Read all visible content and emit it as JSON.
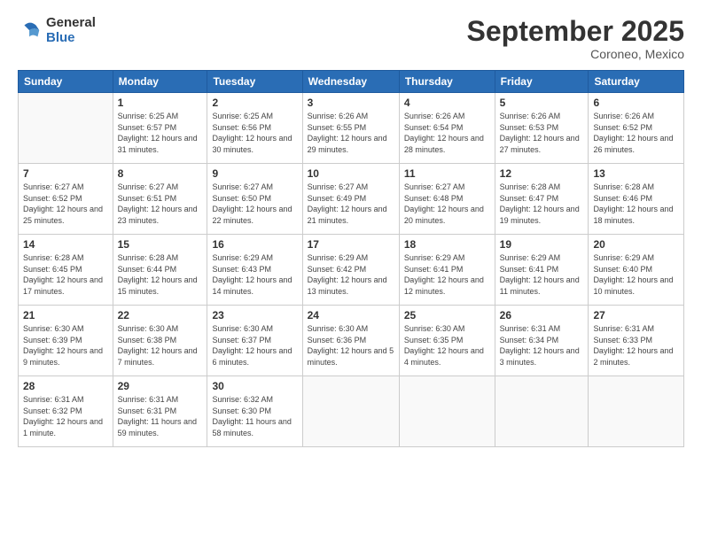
{
  "logo": {
    "general": "General",
    "blue": "Blue"
  },
  "header": {
    "month": "September 2025",
    "location": "Coroneo, Mexico"
  },
  "weekdays": [
    "Sunday",
    "Monday",
    "Tuesday",
    "Wednesday",
    "Thursday",
    "Friday",
    "Saturday"
  ],
  "weeks": [
    [
      {
        "day": "",
        "sunrise": "",
        "sunset": "",
        "daylight": ""
      },
      {
        "day": "1",
        "sunrise": "Sunrise: 6:25 AM",
        "sunset": "Sunset: 6:57 PM",
        "daylight": "Daylight: 12 hours and 31 minutes."
      },
      {
        "day": "2",
        "sunrise": "Sunrise: 6:25 AM",
        "sunset": "Sunset: 6:56 PM",
        "daylight": "Daylight: 12 hours and 30 minutes."
      },
      {
        "day": "3",
        "sunrise": "Sunrise: 6:26 AM",
        "sunset": "Sunset: 6:55 PM",
        "daylight": "Daylight: 12 hours and 29 minutes."
      },
      {
        "day": "4",
        "sunrise": "Sunrise: 6:26 AM",
        "sunset": "Sunset: 6:54 PM",
        "daylight": "Daylight: 12 hours and 28 minutes."
      },
      {
        "day": "5",
        "sunrise": "Sunrise: 6:26 AM",
        "sunset": "Sunset: 6:53 PM",
        "daylight": "Daylight: 12 hours and 27 minutes."
      },
      {
        "day": "6",
        "sunrise": "Sunrise: 6:26 AM",
        "sunset": "Sunset: 6:52 PM",
        "daylight": "Daylight: 12 hours and 26 minutes."
      }
    ],
    [
      {
        "day": "7",
        "sunrise": "Sunrise: 6:27 AM",
        "sunset": "Sunset: 6:52 PM",
        "daylight": "Daylight: 12 hours and 25 minutes."
      },
      {
        "day": "8",
        "sunrise": "Sunrise: 6:27 AM",
        "sunset": "Sunset: 6:51 PM",
        "daylight": "Daylight: 12 hours and 23 minutes."
      },
      {
        "day": "9",
        "sunrise": "Sunrise: 6:27 AM",
        "sunset": "Sunset: 6:50 PM",
        "daylight": "Daylight: 12 hours and 22 minutes."
      },
      {
        "day": "10",
        "sunrise": "Sunrise: 6:27 AM",
        "sunset": "Sunset: 6:49 PM",
        "daylight": "Daylight: 12 hours and 21 minutes."
      },
      {
        "day": "11",
        "sunrise": "Sunrise: 6:27 AM",
        "sunset": "Sunset: 6:48 PM",
        "daylight": "Daylight: 12 hours and 20 minutes."
      },
      {
        "day": "12",
        "sunrise": "Sunrise: 6:28 AM",
        "sunset": "Sunset: 6:47 PM",
        "daylight": "Daylight: 12 hours and 19 minutes."
      },
      {
        "day": "13",
        "sunrise": "Sunrise: 6:28 AM",
        "sunset": "Sunset: 6:46 PM",
        "daylight": "Daylight: 12 hours and 18 minutes."
      }
    ],
    [
      {
        "day": "14",
        "sunrise": "Sunrise: 6:28 AM",
        "sunset": "Sunset: 6:45 PM",
        "daylight": "Daylight: 12 hours and 17 minutes."
      },
      {
        "day": "15",
        "sunrise": "Sunrise: 6:28 AM",
        "sunset": "Sunset: 6:44 PM",
        "daylight": "Daylight: 12 hours and 15 minutes."
      },
      {
        "day": "16",
        "sunrise": "Sunrise: 6:29 AM",
        "sunset": "Sunset: 6:43 PM",
        "daylight": "Daylight: 12 hours and 14 minutes."
      },
      {
        "day": "17",
        "sunrise": "Sunrise: 6:29 AM",
        "sunset": "Sunset: 6:42 PM",
        "daylight": "Daylight: 12 hours and 13 minutes."
      },
      {
        "day": "18",
        "sunrise": "Sunrise: 6:29 AM",
        "sunset": "Sunset: 6:41 PM",
        "daylight": "Daylight: 12 hours and 12 minutes."
      },
      {
        "day": "19",
        "sunrise": "Sunrise: 6:29 AM",
        "sunset": "Sunset: 6:41 PM",
        "daylight": "Daylight: 12 hours and 11 minutes."
      },
      {
        "day": "20",
        "sunrise": "Sunrise: 6:29 AM",
        "sunset": "Sunset: 6:40 PM",
        "daylight": "Daylight: 12 hours and 10 minutes."
      }
    ],
    [
      {
        "day": "21",
        "sunrise": "Sunrise: 6:30 AM",
        "sunset": "Sunset: 6:39 PM",
        "daylight": "Daylight: 12 hours and 9 minutes."
      },
      {
        "day": "22",
        "sunrise": "Sunrise: 6:30 AM",
        "sunset": "Sunset: 6:38 PM",
        "daylight": "Daylight: 12 hours and 7 minutes."
      },
      {
        "day": "23",
        "sunrise": "Sunrise: 6:30 AM",
        "sunset": "Sunset: 6:37 PM",
        "daylight": "Daylight: 12 hours and 6 minutes."
      },
      {
        "day": "24",
        "sunrise": "Sunrise: 6:30 AM",
        "sunset": "Sunset: 6:36 PM",
        "daylight": "Daylight: 12 hours and 5 minutes."
      },
      {
        "day": "25",
        "sunrise": "Sunrise: 6:30 AM",
        "sunset": "Sunset: 6:35 PM",
        "daylight": "Daylight: 12 hours and 4 minutes."
      },
      {
        "day": "26",
        "sunrise": "Sunrise: 6:31 AM",
        "sunset": "Sunset: 6:34 PM",
        "daylight": "Daylight: 12 hours and 3 minutes."
      },
      {
        "day": "27",
        "sunrise": "Sunrise: 6:31 AM",
        "sunset": "Sunset: 6:33 PM",
        "daylight": "Daylight: 12 hours and 2 minutes."
      }
    ],
    [
      {
        "day": "28",
        "sunrise": "Sunrise: 6:31 AM",
        "sunset": "Sunset: 6:32 PM",
        "daylight": "Daylight: 12 hours and 1 minute."
      },
      {
        "day": "29",
        "sunrise": "Sunrise: 6:31 AM",
        "sunset": "Sunset: 6:31 PM",
        "daylight": "Daylight: 11 hours and 59 minutes."
      },
      {
        "day": "30",
        "sunrise": "Sunrise: 6:32 AM",
        "sunset": "Sunset: 6:30 PM",
        "daylight": "Daylight: 11 hours and 58 minutes."
      },
      {
        "day": "",
        "sunrise": "",
        "sunset": "",
        "daylight": ""
      },
      {
        "day": "",
        "sunrise": "",
        "sunset": "",
        "daylight": ""
      },
      {
        "day": "",
        "sunrise": "",
        "sunset": "",
        "daylight": ""
      },
      {
        "day": "",
        "sunrise": "",
        "sunset": "",
        "daylight": ""
      }
    ]
  ]
}
